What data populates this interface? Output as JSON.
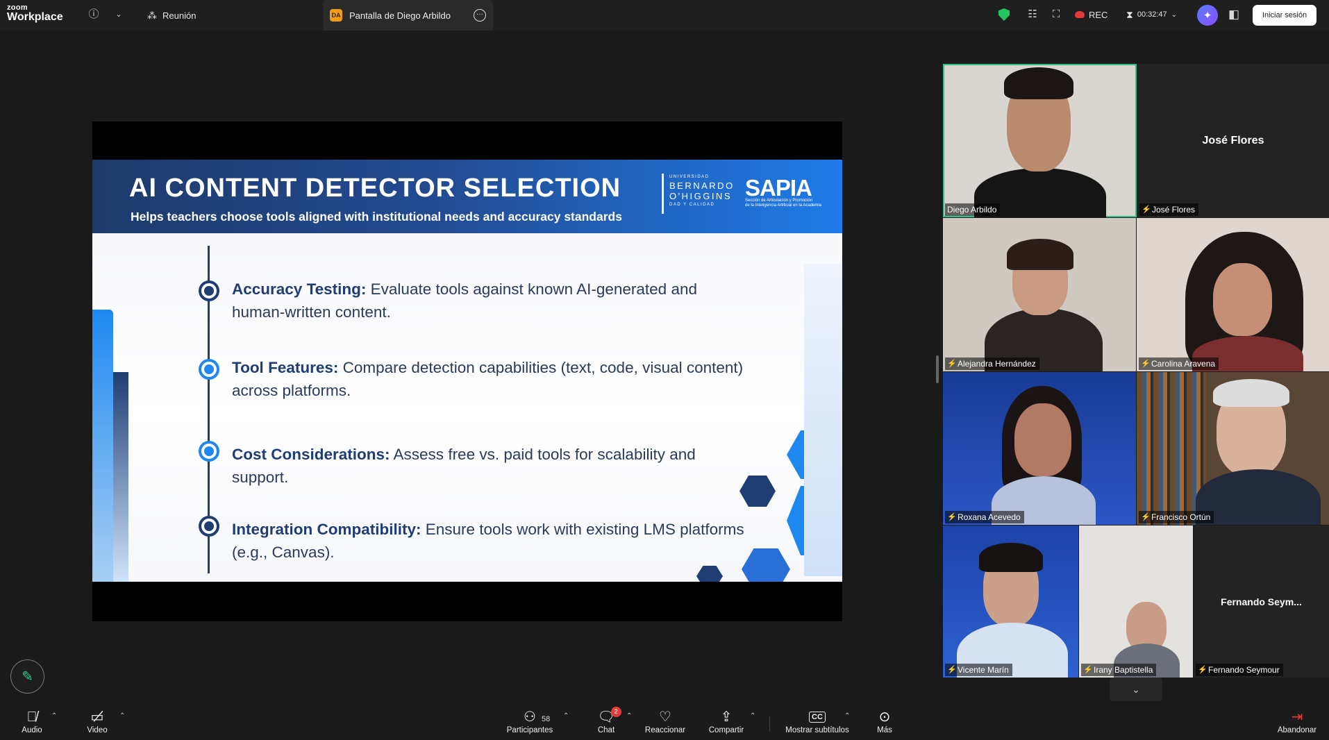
{
  "topbar": {
    "brand_small": "zoom",
    "brand_big": "Workplace",
    "meeting_tab": "Reunión",
    "share_tab_badge": "DA",
    "share_tab": "Pantalla de Diego Arbildo",
    "rec_label": "REC",
    "timer": "00:32:47",
    "login_button": "Iniciar sesión"
  },
  "slide": {
    "title": "AI CONTENT DETECTOR SELECTION",
    "subtitle": "Helps teachers choose tools aligned with institutional needs and accuracy standards",
    "logo_ubo_line1": "UNIVERSIDAD",
    "logo_ubo_line2": "BERNARDO",
    "logo_ubo_line3": "O'HIGGINS",
    "logo_ubo_line4": "DAD Y CALIDAD",
    "logo_sapia": "SAPIA",
    "logo_sapia_sub1": "Sección de Articulación y Promoción",
    "logo_sapia_sub2": "de la Inteligencia Artificial en la Academia",
    "items": [
      {
        "label": "Accuracy Testing:",
        "text": " Evaluate tools against known AI-generated and human-written content."
      },
      {
        "label": "Tool Features:",
        "text": " Compare detection capabilities (text, code, visual content) across platforms."
      },
      {
        "label": "Cost Considerations:",
        "text": " Assess free vs. paid tools for scalability and support."
      },
      {
        "label": "Integration Compatibility:",
        "text": " Ensure tools work with existing LMS platforms (e.g., Canvas)."
      }
    ]
  },
  "participants": {
    "diego": "Diego Arbildo",
    "jose": "José Flores",
    "jose_big": "José Flores",
    "alejandra": "Alejandra Hernández",
    "carolina": "Carolina Aravena",
    "roxana": "Roxana Acevedo",
    "francisco": "Francisco Ortún",
    "vicente": "Vicente Marín",
    "irany": "Irany Baptistella",
    "fernando": "Fernando Seymour",
    "fernando_big": "Fernando  Seym..."
  },
  "toolbar": {
    "audio": "Audio",
    "video": "Video",
    "participants": "Participantes",
    "participants_count": "58",
    "chat": "Chat",
    "chat_badge": "2",
    "react": "Reaccionar",
    "share": "Compartir",
    "captions": "Mostrar subtítulos",
    "captions_icon": "CC",
    "more": "Más",
    "leave": "Abandonar"
  },
  "colors": {
    "slide_navy": "#1f3d73",
    "slide_blue": "#1e88f0",
    "active_speaker": "#2fc08a",
    "mute_red": "#e23b3b"
  },
  "icons": [
    "info-icon",
    "chevron-down-icon",
    "participants-icon",
    "more-icon",
    "shield-icon",
    "notes-icon",
    "layout-icon",
    "record-icon",
    "timer-icon",
    "ai-companion-icon",
    "panel-icon",
    "pencil-icon",
    "mic-muted-icon",
    "video-off-icon",
    "chat-icon",
    "heart-icon",
    "share-screen-icon",
    "cc-icon",
    "leave-icon"
  ]
}
